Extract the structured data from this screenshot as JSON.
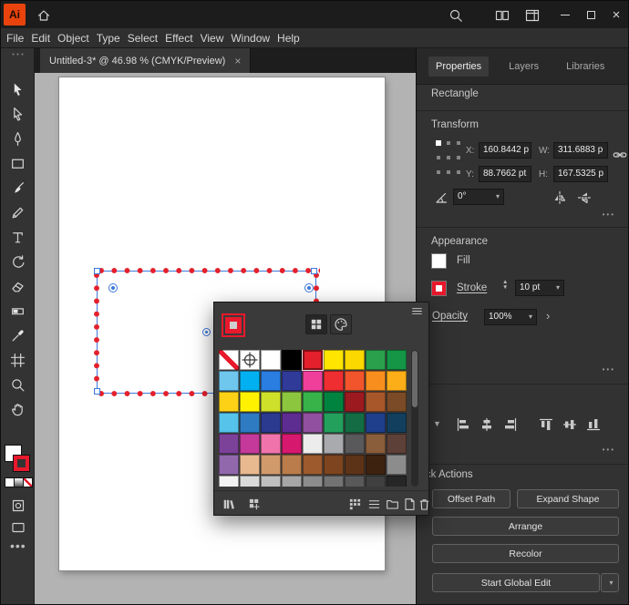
{
  "titlebar": {
    "app_icon_text": "Ai"
  },
  "menubar": {
    "items": [
      "File",
      "Edit",
      "Object",
      "Type",
      "Select",
      "Effect",
      "View",
      "Window",
      "Help"
    ]
  },
  "document_tab": {
    "title": "Untitled-3* @ 46.98 % (CMYK/Preview)",
    "close_glyph": "×"
  },
  "toolbar": {
    "tools": [
      "selection-tool",
      "direct-selection-tool",
      "pen-tool",
      "rectangle-tool",
      "paintbrush-tool",
      "pencil-tool",
      "type-tool",
      "rotate-tool",
      "eraser-tool",
      "gradient-tool",
      "eyedropper-tool",
      "artboard-tool",
      "zoom-tool",
      "hand-tool"
    ]
  },
  "right_panel": {
    "tabs": [
      {
        "label": "Properties",
        "active": true
      },
      {
        "label": "Layers",
        "active": false
      },
      {
        "label": "Libraries",
        "active": false
      }
    ],
    "object_type": "Rectangle",
    "transform": {
      "title": "Transform",
      "x_label": "X:",
      "x_value": "160.8442 p",
      "y_label": "Y:",
      "y_value": "88.7662 pt",
      "w_label": "W:",
      "w_value": "311.6883 p",
      "h_label": "H:",
      "h_value": "167.5325 p",
      "angle_value": "0°",
      "more_glyph": "•••"
    },
    "appearance": {
      "title": "Appearance",
      "fill_label": "Fill",
      "stroke_label": "Stroke",
      "stroke_weight": "10 pt",
      "opacity_label": "Opacity",
      "opacity_value": "100%",
      "more_glyph": "•••"
    },
    "align": {
      "buttons": [
        "align-left-icon",
        "align-h-center-icon",
        "align-right-icon",
        "align-top-icon",
        "align-v-center-icon",
        "align-bottom-icon"
      ],
      "more_glyph": "•••"
    },
    "quick_actions": {
      "title": "Quick Actions",
      "offset_path": "Offset Path",
      "expand_shape": "Expand Shape",
      "arrange": "Arrange",
      "recolor": "Recolor",
      "start_global_edit": "Start Global Edit"
    }
  },
  "swatches_panel": {
    "stroke_color": "#e8192c",
    "selection_color": "#3c78dc",
    "footer_icons": [
      "swatch-libraries-icon",
      "library-add-icon",
      "swatch-kinds-icon",
      "swatch-options-icon",
      "new-color-group-icon",
      "new-swatch-icon",
      "delete-swatch-icon"
    ],
    "selected": {
      "row": 0,
      "col": 4
    },
    "rows": [
      [
        "none",
        "registration",
        "#ffffff",
        "#000000",
        "#e4202c",
        "#ffe500",
        "#fbd800",
        "#2aa04c",
        "#149646"
      ],
      [
        "#6fc7ee",
        "#00b0f0",
        "#2a7de1",
        "#303a99",
        "#ef3f9b",
        "#ee2e31",
        "#f2552c",
        "#f78e1e",
        "#fbae17"
      ],
      [
        "#fcd116",
        "#fff200",
        "#cfe02a",
        "#8cc63e",
        "#37b34a",
        "#00833e",
        "#9c1a1f",
        "#a8572a",
        "#7a4b26"
      ],
      [
        "#55c3ea",
        "#2f7bc2",
        "#2b3a8f",
        "#5e2d91",
        "#9150a0",
        "#23a05c",
        "#146c44",
        "#1f3e8c",
        "#123f5e"
      ],
      [
        "#7c4199",
        "#c4399a",
        "#f173ac",
        "#d6186e",
        "#ececec",
        "#a8aaad",
        "#59595c",
        "#8a5d3b",
        "#5d4037"
      ],
      [
        "#9268ac",
        "#e8b88f",
        "#d19a6b",
        "#b97c4a",
        "#9c5a2d",
        "#7d441f",
        "#5d3317",
        "#3e2210",
        "#8c8c8c"
      ],
      [
        "#f2f2f2",
        "#d9d9d9",
        "#bfbfbf",
        "#a6a6a6",
        "#8c8c8c",
        "#737373",
        "#595959",
        "#404040",
        "#262626"
      ]
    ]
  }
}
